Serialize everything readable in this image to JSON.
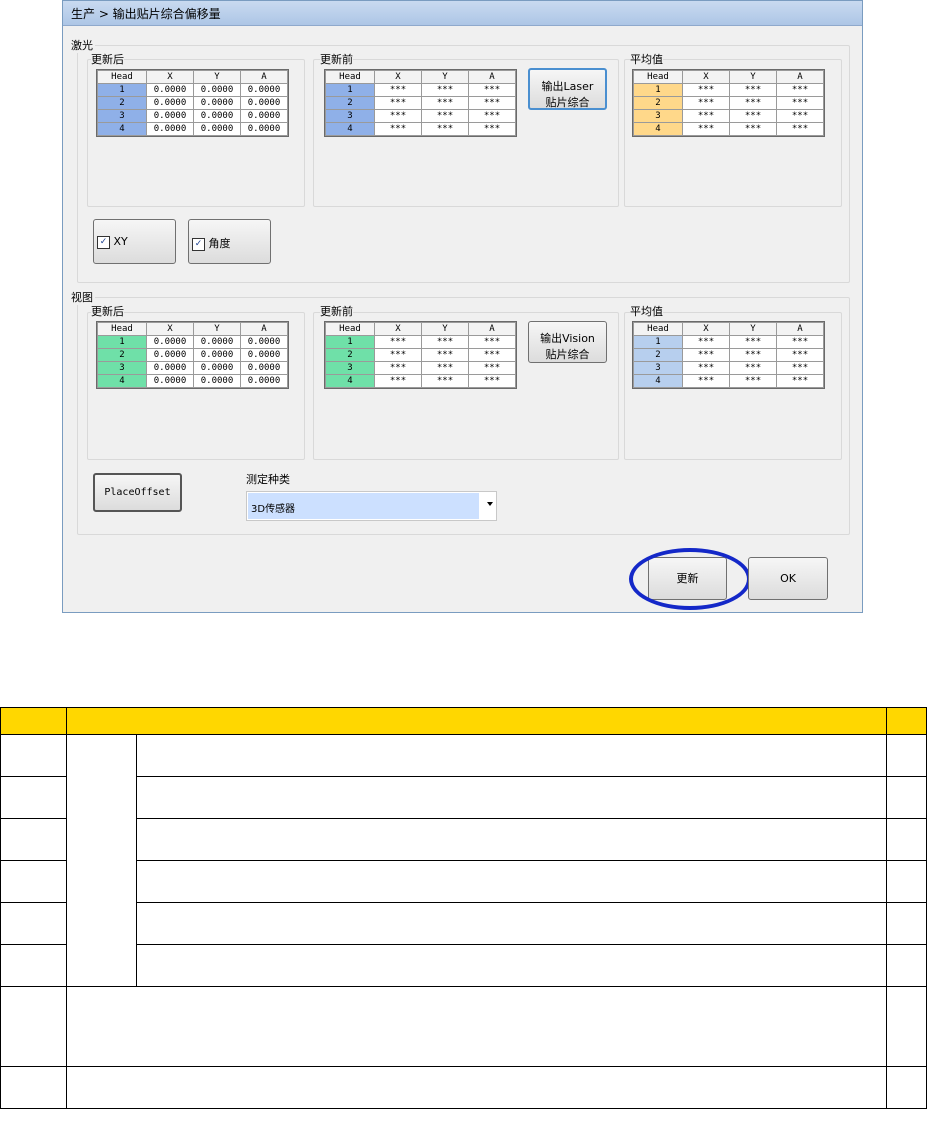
{
  "window": {
    "breadcrumb": "生产 > 输出贴片综合偏移量"
  },
  "table_header": [
    "Head",
    "X",
    "Y",
    "A"
  ],
  "laser": {
    "section_label": "激光",
    "after_label": "更新后",
    "before_label": "更新前",
    "avg_label": "平均值",
    "after_rows": [
      [
        "1",
        "0.0000",
        "0.0000",
        "0.0000"
      ],
      [
        "2",
        "0.0000",
        "0.0000",
        "0.0000"
      ],
      [
        "3",
        "0.0000",
        "0.0000",
        "0.0000"
      ],
      [
        "4",
        "0.0000",
        "0.0000",
        "0.0000"
      ]
    ],
    "before_rows": [
      [
        "1",
        "***",
        "***",
        "***"
      ],
      [
        "2",
        "***",
        "***",
        "***"
      ],
      [
        "3",
        "***",
        "***",
        "***"
      ],
      [
        "4",
        "***",
        "***",
        "***"
      ]
    ],
    "avg_rows": [
      [
        "1",
        "***",
        "***",
        "***"
      ],
      [
        "2",
        "***",
        "***",
        "***"
      ],
      [
        "3",
        "***",
        "***",
        "***"
      ],
      [
        "4",
        "***",
        "***",
        "***"
      ]
    ],
    "output_button_line1": "输出Laser",
    "output_button_line2": "贴片综合",
    "xy_checkbox_label": "XY",
    "angle_checkbox_label": "角度"
  },
  "vision": {
    "section_label": "视图",
    "after_label": "更新后",
    "before_label": "更新前",
    "avg_label": "平均值",
    "after_rows": [
      [
        "1",
        "0.0000",
        "0.0000",
        "0.0000"
      ],
      [
        "2",
        "0.0000",
        "0.0000",
        "0.0000"
      ],
      [
        "3",
        "0.0000",
        "0.0000",
        "0.0000"
      ],
      [
        "4",
        "0.0000",
        "0.0000",
        "0.0000"
      ]
    ],
    "before_rows": [
      [
        "1",
        "***",
        "***",
        "***"
      ],
      [
        "2",
        "***",
        "***",
        "***"
      ],
      [
        "3",
        "***",
        "***",
        "***"
      ],
      [
        "4",
        "***",
        "***",
        "***"
      ]
    ],
    "avg_rows": [
      [
        "1",
        "***",
        "***",
        "***"
      ],
      [
        "2",
        "***",
        "***",
        "***"
      ],
      [
        "3",
        "***",
        "***",
        "***"
      ],
      [
        "4",
        "***",
        "***",
        "***"
      ]
    ],
    "output_button_line1": "输出Vision",
    "output_button_line2": "贴片综合",
    "place_offset_button": "PlaceOffset",
    "measure_type_label": "测定种类",
    "measure_type_value": "3D传感器"
  },
  "footer": {
    "update_button": "更新",
    "ok_button": "OK"
  },
  "colors": {
    "laser_head": "#8fb0e8",
    "vision_head": "#6fe0a8",
    "avg_laser_head": "#ffd88a",
    "avg_vision_head": "#b7cfee",
    "spec_header": "#ffd700",
    "highlight_ring": "#1428c8"
  }
}
